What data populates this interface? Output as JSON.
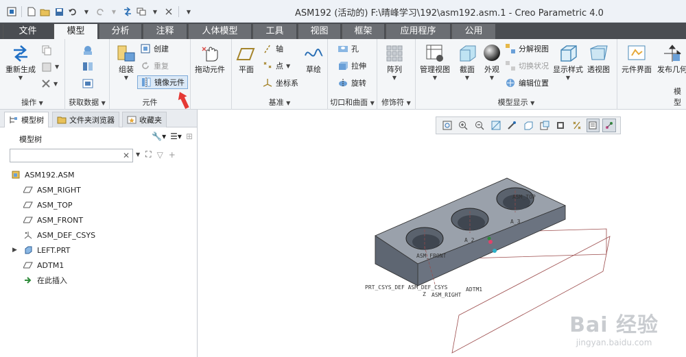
{
  "window": {
    "title": "ASM192 (活动的) F:\\晴峰学习\\192\\asm192.asm.1 - Creo Parametric 4.0"
  },
  "tabs": [
    "文件",
    "模型",
    "分析",
    "注释",
    "人体模型",
    "工具",
    "视图",
    "框架",
    "应用程序",
    "公用"
  ],
  "ribbon": {
    "operations": {
      "regen": "重新生成",
      "label": "操作"
    },
    "getdata": {
      "label": "获取数据"
    },
    "component": {
      "assemble": "组装",
      "create": "创建",
      "repeat": "重复",
      "mirror": "镜像元件",
      "label": "元件"
    },
    "drag": {
      "label": "拖动元件"
    },
    "datum": {
      "plane": "平面",
      "axis": "轴",
      "point": "点",
      "csys": "坐标系",
      "sketch": "草绘",
      "label": "基准"
    },
    "cut": {
      "hole": "孔",
      "extrude": "拉伸",
      "revolve": "旋转",
      "label": "切口和曲面"
    },
    "modifier": {
      "pattern": "阵列",
      "label": "修饰符"
    },
    "display": {
      "manage_views": "管理视图",
      "section": "截面",
      "appearance": "外观",
      "explode": "分解视图",
      "toggle": "切换状况",
      "edit_pos": "编辑位置",
      "display_style": "显示样式",
      "perspective": "透视图",
      "label": "模型显示"
    },
    "extra": {
      "comp_interface": "元件界面",
      "publish": "发布几何",
      "label": "模型"
    }
  },
  "panel": {
    "tabs": [
      "模型树",
      "文件夹浏览器",
      "收藏夹"
    ],
    "title": "模型树",
    "search_placeholder": "",
    "tree": [
      {
        "label": "ASM192.ASM",
        "icon": "assembly-icon"
      },
      {
        "label": "ASM_RIGHT",
        "icon": "datum-plane-icon"
      },
      {
        "label": "ASM_TOP",
        "icon": "datum-plane-icon"
      },
      {
        "label": "ASM_FRONT",
        "icon": "datum-plane-icon"
      },
      {
        "label": "ASM_DEF_CSYS",
        "icon": "csys-icon"
      },
      {
        "label": "LEFT.PRT",
        "icon": "part-icon"
      },
      {
        "label": "ADTM1",
        "icon": "datum-plane-icon"
      },
      {
        "label": "在此插入",
        "icon": "insert-here-icon"
      }
    ]
  },
  "graphics": {
    "labels": {
      "asm_top": "ASM_TOP",
      "a3": "A_3",
      "a2": "A_2",
      "asm_front": "ASM_FRONT",
      "csys": "PRT_CSYS_DEF ASM_DEF_CSYS",
      "adtm1": "ADTM1",
      "asm_right": "ASM_RIGHT",
      "z": "Z"
    }
  },
  "watermark": {
    "brand": "Bai 经验",
    "url": "jingyan.baidu.com"
  },
  "colors": {
    "accent": "#1f6fc5",
    "tabbar": "#4a4d52",
    "arrow": "#e53935"
  }
}
